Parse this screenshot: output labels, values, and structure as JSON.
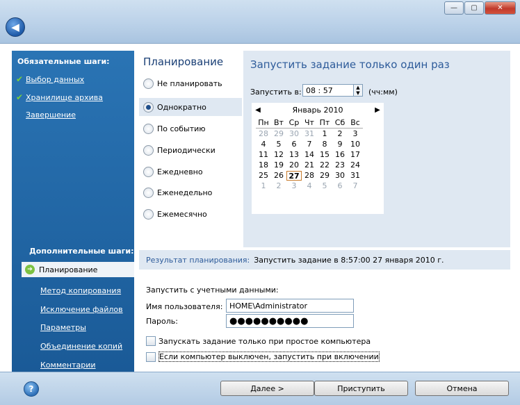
{
  "window": {
    "minimize": "—",
    "maximize": "▢",
    "close": "✕"
  },
  "sidebar": {
    "required_title": "Обязательные шаги:",
    "required_items": [
      {
        "label": "Выбор данных",
        "done": true
      },
      {
        "label": "Хранилище архива",
        "done": true
      },
      {
        "label": "Завершение",
        "done": false
      }
    ],
    "optional_title": "Дополнительные шаги:",
    "active_item": "Планирование",
    "optional_items": [
      "Метод копирования",
      "Исключение файлов",
      "Параметры",
      "Объединение копий",
      "Комментарии"
    ]
  },
  "schedule": {
    "heading": "Планирование",
    "options": [
      "Не планировать",
      "Однократно",
      "По событию",
      "Периодически",
      "Ежедневно",
      "Еженедельно",
      "Ежемесячно"
    ],
    "selected": "Однократно"
  },
  "panel": {
    "title": "Запустить задание только один раз",
    "time_label": "Запустить в:",
    "time_value": "08 : 57",
    "time_format": "(чч:мм)"
  },
  "calendar": {
    "month": "Январь 2010",
    "days_of_week": [
      "Пн",
      "Вт",
      "Ср",
      "Чт",
      "Пт",
      "Сб",
      "Вс"
    ],
    "weeks": [
      [
        "28",
        "29",
        "30",
        "31",
        "1",
        "2",
        "3"
      ],
      [
        "4",
        "5",
        "6",
        "7",
        "8",
        "9",
        "10"
      ],
      [
        "11",
        "12",
        "13",
        "14",
        "15",
        "16",
        "17"
      ],
      [
        "18",
        "19",
        "20",
        "21",
        "22",
        "23",
        "24"
      ],
      [
        "25",
        "26",
        "27",
        "28",
        "29",
        "30",
        "31"
      ],
      [
        "1",
        "2",
        "3",
        "4",
        "5",
        "6",
        "7"
      ]
    ],
    "selected_day": "27"
  },
  "result": {
    "label": "Результат планирования:",
    "value": "Запустить задание в 8:57:00 27 января 2010 г."
  },
  "credentials": {
    "title": "Запустить с учетными данными:",
    "user_label": "Имя пользователя:",
    "user_value": "HOME\\Administrator",
    "password_label": "Пароль:",
    "password_value": "●●●●●●●●●●"
  },
  "checkboxes": [
    "Запускать задание только при простое компьютера",
    "Если компьютер выключен, запустить при включении"
  ],
  "buttons": {
    "next": "Далее >",
    "proceed": "Приступить",
    "cancel": "Отмена"
  }
}
